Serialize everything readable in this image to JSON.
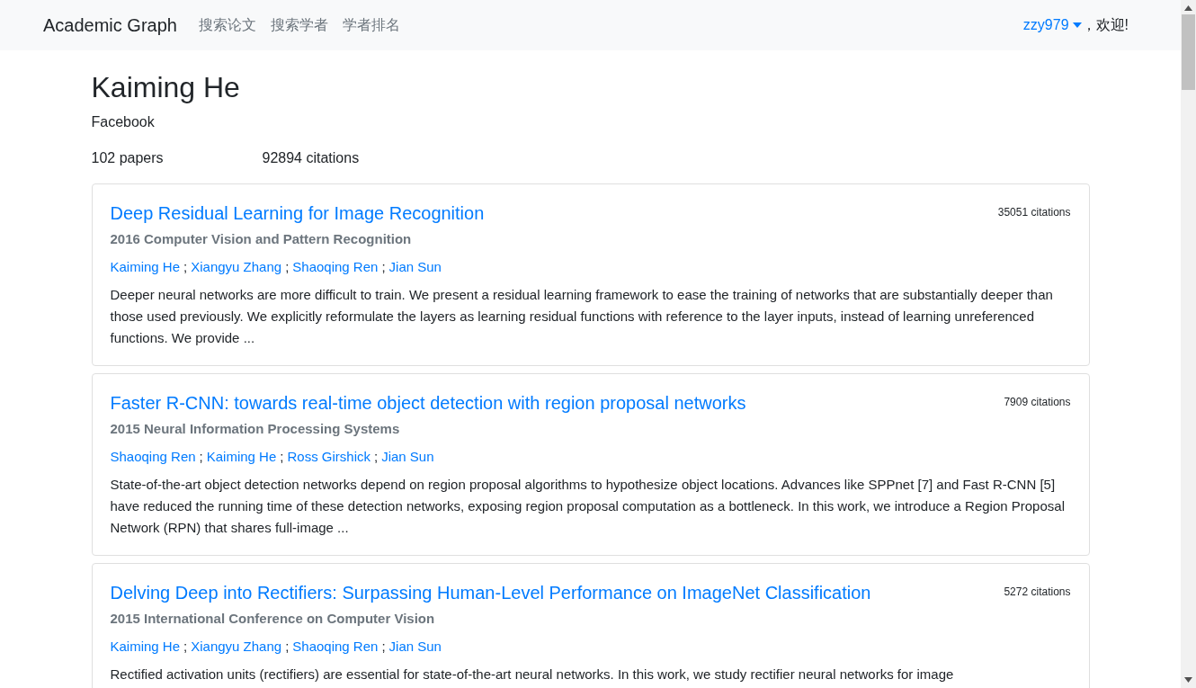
{
  "navbar": {
    "brand": "Academic Graph",
    "links": [
      "搜索论文",
      "搜索学者",
      "学者排名"
    ],
    "user": "zzy979",
    "greeting": "，欢迎!"
  },
  "scholar": {
    "name": "Kaiming He",
    "affiliation": "Facebook",
    "papers": "102 papers",
    "citations": "92894 citations"
  },
  "papers": [
    {
      "title": "Deep Residual Learning for Image Recognition",
      "citations": "35051 citations",
      "venue": "2016 Computer Vision and Pattern Recognition",
      "authors": [
        {
          "name": "Kaiming He"
        },
        {
          "separator": ";",
          "name": "Xiangyu Zhang"
        },
        {
          "separator": ";",
          "name": "Shaoqing Ren"
        },
        {
          "separator": ";",
          "name": "Jian Sun"
        }
      ],
      "abstract": "Deeper neural networks are more difficult to train. We present a residual learning framework to ease the training of networks that are substantially deeper than those used previously. We explicitly reformulate the layers as learning residual functions with reference to the layer inputs, instead of learning unreferenced functions. We provide ..."
    },
    {
      "title": "Faster R-CNN: towards real-time object detection with region proposal networks",
      "citations": "7909 citations",
      "venue": "2015 Neural Information Processing Systems",
      "authors": [
        {
          "name": "Shaoqing Ren"
        },
        {
          "separator": ";",
          "name": "Kaiming He"
        },
        {
          "separator": ";",
          "name": "Ross Girshick"
        },
        {
          "separator": ";",
          "name": "Jian Sun"
        }
      ],
      "abstract": "State-of-the-art object detection networks depend on region proposal algorithms to hypothesize object locations. Advances like SPPnet [7] and Fast R-CNN [5] have reduced the running time of these detection networks, exposing region proposal computation as a bottleneck. In this work, we introduce a Region Proposal Network (RPN) that shares full-image ..."
    },
    {
      "title": "Delving Deep into Rectifiers: Surpassing Human-Level Performance on ImageNet Classification",
      "citations": "5272 citations",
      "venue": "2015 International Conference on Computer Vision",
      "authors": [
        {
          "name": "Kaiming He"
        },
        {
          "separator": ";",
          "name": "Xiangyu Zhang"
        },
        {
          "separator": ";",
          "name": "Shaoqing Ren"
        },
        {
          "separator": ";",
          "name": "Jian Sun"
        }
      ],
      "abstract": "Rectified activation units (rectifiers) are essential for state-of-the-art neural networks. In this work, we study rectifier neural networks for image"
    }
  ]
}
